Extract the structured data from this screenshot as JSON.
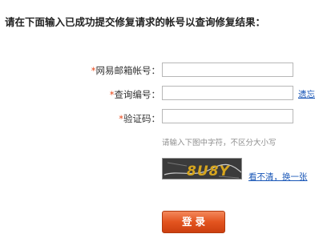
{
  "title": "请在下面输入已成功提交修复请求的帐号以查询修复结果：",
  "form": {
    "email": {
      "required_mark": "*",
      "label": "网易邮箱帐号：",
      "value": ""
    },
    "query_code": {
      "required_mark": "*",
      "label": "查询编号：",
      "value": "",
      "forgot_link": "遗忘"
    },
    "captcha": {
      "required_mark": "*",
      "label": "验证码：",
      "value": ""
    },
    "captcha_hint": "请输入下图中字符，不区分大小写",
    "captcha_image": {
      "text": "8U8Y",
      "text_color": "#d6a51e",
      "background": "#3b3b3b"
    },
    "refresh_link": "看不清，换一张",
    "submit_label": "登录"
  },
  "colors": {
    "accent": "#e3541f",
    "link": "#1a57b7",
    "required": "#e8481a"
  }
}
